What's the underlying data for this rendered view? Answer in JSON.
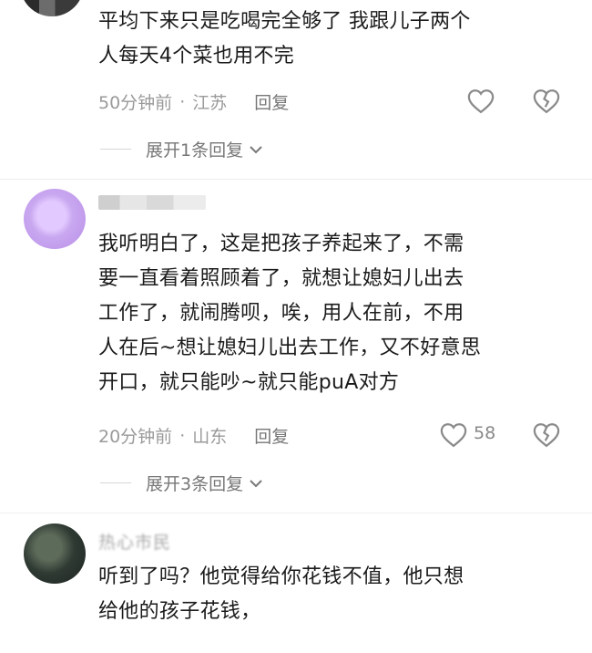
{
  "comments": [
    {
      "username": "",
      "lines": [
        "平均下来只是吃喝完全够了  我跟儿子两个",
        "人每天4个菜也用不完"
      ],
      "time": "50分钟前",
      "location": "江苏",
      "reply_label": "回复",
      "likes": "",
      "expand_label": "展开1条回复"
    },
    {
      "username": "",
      "lines": [
        "我听明白了，这是把孩子养起来了，不需",
        "要一直看着照顾着了，就想让媳妇儿出去",
        "工作了，就闹腾呗，唉，用人在前，不用",
        "人在后~想让媳妇儿出去工作，又不好意思",
        "开口，就只能吵~就只能puA对方"
      ],
      "time": "20分钟前",
      "location": "山东",
      "reply_label": "回复",
      "likes": "58",
      "expand_label": "展开3条回复"
    },
    {
      "username": "热心市民",
      "lines": [
        "听到了吗？他觉得给你花钱不值，他只想",
        "给他的孩子花钱，"
      ],
      "time": "",
      "location": "",
      "reply_label": "",
      "likes": "",
      "expand_label": ""
    }
  ],
  "separator": "·",
  "colors": {
    "text": "#1b1b1b",
    "meta": "#9a9a9a",
    "icon": "#8a8a8a",
    "avatar2": "#c9a8f0"
  }
}
